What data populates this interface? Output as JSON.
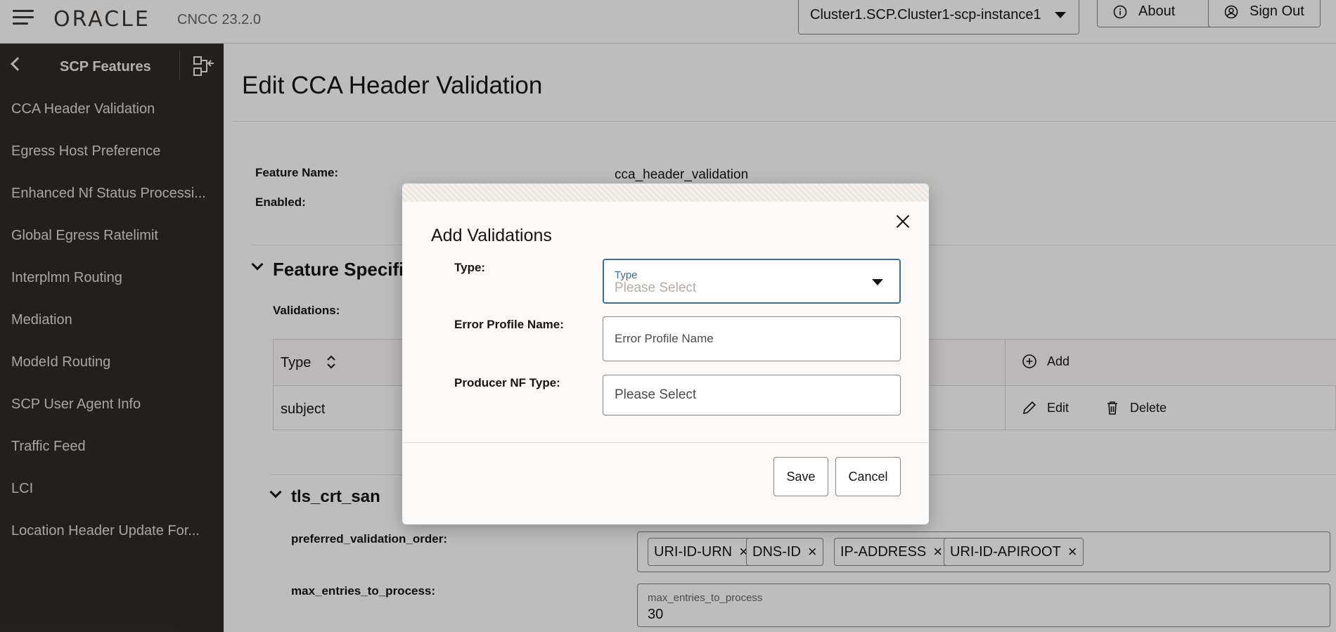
{
  "header": {
    "brand": "ORACLE",
    "version": "CNCC 23.2.0",
    "instance": "Cluster1.SCP.Cluster1-scp-instance1",
    "about_label": "About",
    "signout_label": "Sign Out"
  },
  "sidebar": {
    "title": "SCP Features",
    "items": [
      {
        "label": "CCA Header Validation"
      },
      {
        "label": "Egress Host Preference"
      },
      {
        "label": "Enhanced Nf Status Processi..."
      },
      {
        "label": "Global Egress Ratelimit"
      },
      {
        "label": "Interplmn Routing"
      },
      {
        "label": "Mediation"
      },
      {
        "label": "ModeId Routing"
      },
      {
        "label": "SCP User Agent Info"
      },
      {
        "label": "Traffic Feed"
      },
      {
        "label": "LCI"
      },
      {
        "label": "Location Header Update For..."
      }
    ]
  },
  "main": {
    "page_title": "Edit CCA Header Validation",
    "feature_name_label": "Feature Name:",
    "feature_name_value": "cca_header_validation",
    "enabled_label": "Enabled:",
    "feature_section_title": "Feature Specific",
    "validations_label": "Validations:",
    "table": {
      "col_type": "Type",
      "add_label": "Add",
      "rows": [
        {
          "type": "subject",
          "edit": "Edit",
          "delete": "Delete"
        }
      ]
    },
    "tls_section_title": "tls_crt_san",
    "preferred_order_label": "preferred_validation_order:",
    "preferred_order_chips": [
      "URI-ID-URN",
      "DNS-ID",
      "IP-ADDRESS",
      "URI-ID-APIROOT"
    ],
    "max_entries_label": "max_entries_to_process:",
    "max_entries_field_label": "max_entries_to_process",
    "max_entries_value": "30"
  },
  "dialog": {
    "title": "Add Validations",
    "type_label": "Type:",
    "type_field_label": "Type",
    "type_placeholder": "Please Select",
    "error_profile_label": "Error Profile Name:",
    "error_profile_placeholder": "Error Profile Name",
    "producer_label": "Producer NF Type:",
    "producer_placeholder": "Please Select",
    "save_label": "Save",
    "cancel_label": "Cancel"
  }
}
